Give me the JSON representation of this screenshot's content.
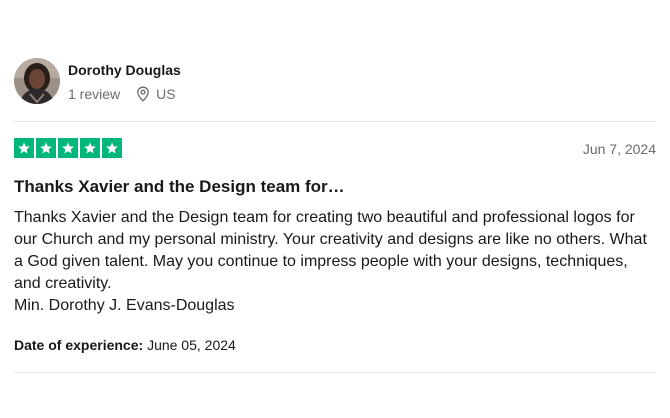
{
  "reviewer": {
    "name": "Dorothy Douglas",
    "review_count": "1 review",
    "location": "US",
    "avatar_icon": "user-photo-avatar"
  },
  "review": {
    "rating": 5,
    "max_rating": 5,
    "star_color": "#00b67a",
    "date": "Jun 7, 2024",
    "title": "Thanks Xavier and the Design team for…",
    "body": "Thanks Xavier and the Design team for creating two beautiful and professional logos for our Church and my personal ministry. Your creativity and designs are like no others. What a God given talent. May you continue to impress people with your designs, techniques, and creativity.",
    "signature": "Min. Dorothy J. Evans-Douglas",
    "experience_label": "Date of experience:",
    "experience_date": "June 05, 2024"
  },
  "icons": {
    "location": "map-pin-icon",
    "star": "star-icon"
  }
}
